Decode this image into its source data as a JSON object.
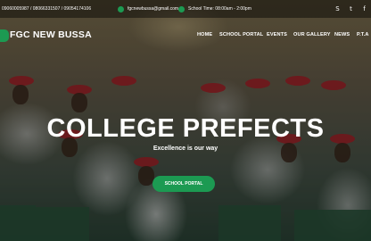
{
  "topbar": {
    "phones": "09060005987 / 08066331507 / 09054174106",
    "email": "fgcnewbussa@gmail.com",
    "school_time": "School Time: 08:00am - 2:00pm",
    "social_icons": [
      "skype-icon",
      "twitter-icon",
      "facebook-icon"
    ]
  },
  "brand": {
    "name": "FGC NEW BUSSA"
  },
  "nav": {
    "items": [
      "HOME",
      "SCHOOL PORTAL",
      "EVENTS",
      "OUR GALLERY",
      "NEWS",
      "P.T.A"
    ]
  },
  "hero": {
    "title": "COLLEGE PREFECTS",
    "subtitle": "Excellence is our way",
    "button": "SCHOOL PORTAL"
  },
  "colors": {
    "accent": "#1c9a52"
  }
}
